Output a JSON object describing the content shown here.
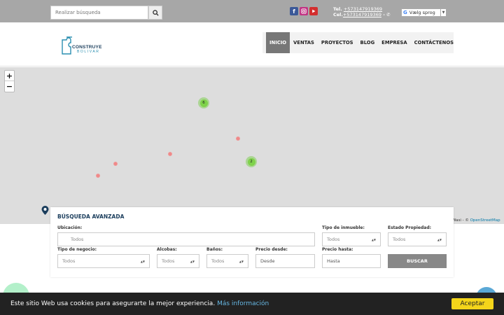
{
  "topbar": {
    "search_placeholder": "Realizar búsqueda",
    "phone_label": "Tel.",
    "phone": "+573147919369",
    "cell_label": "Cel.",
    "cell": "+573147919369",
    "language": "Vælg sprog"
  },
  "header": {
    "logo_line1": "CONSTRUYE",
    "logo_line2": "BOLIVAR",
    "nav": [
      "INICIO",
      "VENTAS",
      "PROYECTOS",
      "BLOG",
      "EMPRESA",
      "CONTÁCTENOS"
    ]
  },
  "map": {
    "zoom_in": "+",
    "zoom_out": "−",
    "clusters": [
      "6",
      "2"
    ],
    "attribution_prefix": "Wasi - ©",
    "attribution_link": "OpenStreetMap"
  },
  "search": {
    "title": "BÚSQUEDA AVANZADA",
    "ubicacion_label": "Ubicación:",
    "ubicacion_placeholder": "Todos",
    "tipo_inmueble_label": "Tipo de inmueble:",
    "tipo_inmueble_value": "Todos",
    "estado_label": "Estado Propiedad:",
    "estado_value": "Todos",
    "tipo_negocio_label": "Tipo de negocio:",
    "tipo_negocio_value": "Todos",
    "alcobas_label": "Alcobas:",
    "alcobas_value": "Todos",
    "banos_label": "Baños:",
    "banos_value": "Todos",
    "precio_desde_label": "Precio desde:",
    "precio_desde_placeholder": "Desde",
    "precio_hasta_label": "Precio hasta:",
    "precio_hasta_placeholder": "Hasta",
    "buscar_label": "BUSCAR"
  },
  "cookie": {
    "text": "Este sitio Web usa cookies para asegurarte la mejor experiencia.",
    "link": "Más información",
    "accept": "Aceptar"
  },
  "colors": {
    "accent": "#1a3d5c",
    "cookie_button": "#f4d51a"
  }
}
